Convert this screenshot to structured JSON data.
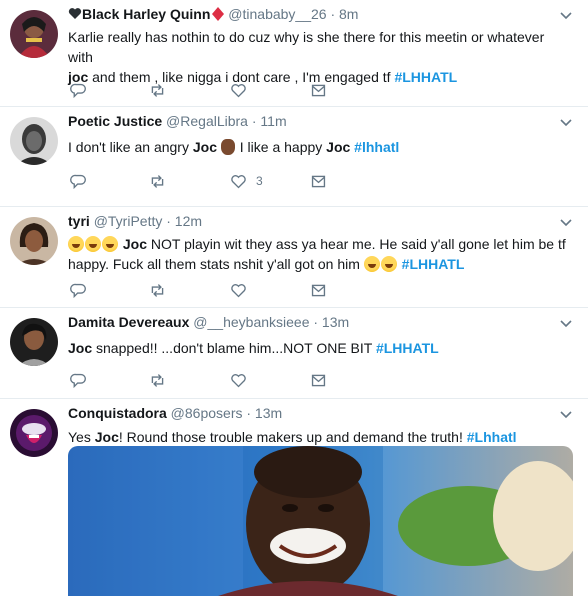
{
  "tweets": [
    {
      "name": "❤️Black Harley Quinn♦️",
      "name_display": "Black Harley Quinn",
      "handle": "@tinababy__26",
      "time": "· 8m",
      "text_parts": [
        "Karlie really has nothin to do cuz why is she there for this meetin or whatever with",
        "joc",
        "and them , like nigga i dont care , I'm engaged tf",
        "#LHHATL"
      ]
    },
    {
      "name": "Poetic Justice",
      "handle": "@RegalLibra",
      "time": "· 11m",
      "text_parts": [
        "I don't like an angry",
        "Joc",
        "I like a happy",
        "Joc",
        "#lhhatl"
      ],
      "likes": "3"
    },
    {
      "name": "tyri",
      "handle": "@TyriPetty",
      "time": "· 12m",
      "text_parts": [
        "Joc",
        "NOT playin wit they ass ya hear me. He said y'all gone let him be tf",
        "happy. Fuck all them stats nshit y'all got on him",
        "#LHHATL"
      ]
    },
    {
      "name": "Damita Devereaux",
      "handle": "@__heybanksieee",
      "time": "· 13m",
      "text_parts": [
        "Joc",
        "snapped!! ...don't blame him...NOT ONE BIT",
        "#LHHATL"
      ]
    },
    {
      "name": "Conquistadora",
      "handle": "@86posers",
      "time": "· 13m",
      "text_parts": [
        "Yes",
        "Joc",
        "! Round those trouble makers up and demand the truth!",
        "#Lhhatl"
      ]
    }
  ],
  "icons": {
    "reply": "reply-icon",
    "retweet": "retweet-icon",
    "like": "heart-icon",
    "dm": "envelope-icon",
    "caret": "chevron-down-icon"
  },
  "colors": {
    "accent": "#1b95e0",
    "muted": "#657786",
    "divider": "#e6ecf0"
  }
}
